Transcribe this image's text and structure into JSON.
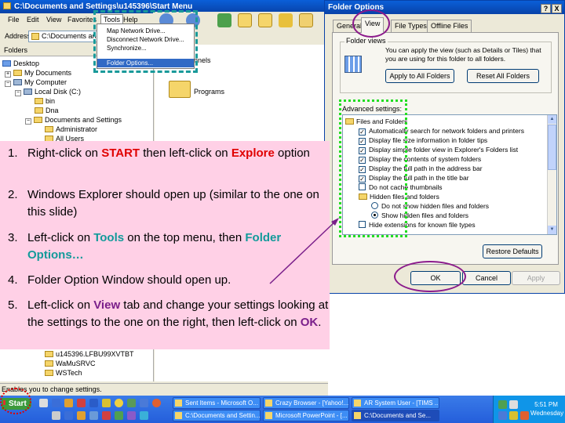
{
  "explorer": {
    "title": "C:\\Documents and Settings\\u145396\\Start Menu",
    "menus": [
      "File",
      "Edit",
      "View",
      "Favorites",
      "Tools",
      "Help"
    ],
    "address_label": "Address",
    "address_value": "C:\\Documents and",
    "folders_header": "Folders",
    "tree": [
      "Desktop",
      "My Documents",
      "My Computer",
      "Local Disk (C:)",
      "bin",
      "Dna",
      "Documents and Settings",
      "Administrator",
      "All Users",
      "u145396.LFBU99XVTBT",
      "WaMuSRVC",
      "WSTech"
    ],
    "right_items": [
      "Programs"
    ],
    "right_partial_label": "hannels",
    "status": "Enables you to change settings."
  },
  "tools_menu": {
    "items": [
      "Map Network Drive...",
      "Disconnect Network Drive...",
      "Synchronize...",
      "Folder Options..."
    ],
    "selected": "Folder Options..."
  },
  "dialog": {
    "title": "Folder Options",
    "title_buttons": [
      "?",
      "X"
    ],
    "tabs": [
      "General",
      "View",
      "File Types",
      "Offline Files"
    ],
    "active_tab": "View",
    "folder_views_label": "Folder views",
    "folder_views_text": "You can apply the view (such as Details or Tiles) that you are using for this folder to all folders.",
    "apply_all_button": "Apply to All Folders",
    "reset_all_button": "Reset All Folders",
    "advanced_label": "Advanced settings:",
    "advanced_items": [
      {
        "label": "Files and Folders",
        "kind": "folder"
      },
      {
        "label": "Automatically search for network folders and printers",
        "kind": "checkbox",
        "checked": true
      },
      {
        "label": "Display file size information in folder tips",
        "kind": "checkbox",
        "checked": true
      },
      {
        "label": "Display simple folder view in Explorer's Folders list",
        "kind": "checkbox",
        "checked": true
      },
      {
        "label": "Display the contents of system folders",
        "kind": "checkbox",
        "checked": true
      },
      {
        "label": "Display the full path in the address bar",
        "kind": "checkbox",
        "checked": true
      },
      {
        "label": "Display the full path in the title bar",
        "kind": "checkbox",
        "checked": true
      },
      {
        "label": "Do not cache thumbnails",
        "kind": "checkbox",
        "checked": false
      },
      {
        "label": "Hidden files and folders",
        "kind": "folder"
      },
      {
        "label": "Do not show hidden files and folders",
        "kind": "radio",
        "checked": false
      },
      {
        "label": "Show hidden files and folders",
        "kind": "radio",
        "checked": true
      },
      {
        "label": "Hide extensions for known file types",
        "kind": "checkbox",
        "checked": false
      }
    ],
    "restore_defaults_button": "Restore Defaults",
    "ok_button": "OK",
    "cancel_button": "Cancel",
    "apply_button": "Apply"
  },
  "instructions": {
    "steps": [
      {
        "n": "1.",
        "parts": [
          [
            "Right-click on ",
            ""
          ],
          [
            "START",
            "red"
          ],
          [
            " then left-click on ",
            ""
          ],
          [
            "Explore",
            "red"
          ],
          [
            " option",
            ""
          ]
        ]
      },
      {
        "n": "2.",
        "parts": [
          [
            "Windows Explorer should open up (similar to the one on this slide)",
            ""
          ]
        ]
      },
      {
        "n": "3.",
        "parts": [
          [
            "Left-click on ",
            ""
          ],
          [
            "Tools",
            "teal"
          ],
          [
            " on the top menu, then ",
            ""
          ],
          [
            "Folder Options…",
            "teal"
          ]
        ]
      },
      {
        "n": "4.",
        "parts": [
          [
            "Folder Option Window should open up.",
            ""
          ]
        ]
      },
      {
        "n": "5.",
        "parts": [
          [
            "Left-click on ",
            ""
          ],
          [
            "View",
            "purple"
          ],
          [
            " tab and change your settings looking at the settings to the one on the right, then left-click on ",
            ""
          ],
          [
            "OK",
            "purple"
          ],
          [
            ".",
            ""
          ]
        ]
      }
    ]
  },
  "taskbar": {
    "start_label": "Start",
    "tasks": [
      "Sent Items - Microsoft O...",
      "Crazy Browser - [Yahoo!...",
      "AR System User - [TIMS ...",
      "C:\\Documents and Settin...",
      "Microsoft PowerPoint - [...",
      "C:\\Documents and Se..."
    ],
    "clock_time": "5:51 PM",
    "clock_day": "Wednesday"
  },
  "colors": {
    "xp_blue": "#0842a8",
    "instruction_bg": "#ffd0e6",
    "keyword_red": "#e00000",
    "keyword_teal": "#129a9a",
    "keyword_purple": "#7a1f8a",
    "highlight_green": "#22dd22",
    "highlight_teal": "#1a9a9a"
  }
}
